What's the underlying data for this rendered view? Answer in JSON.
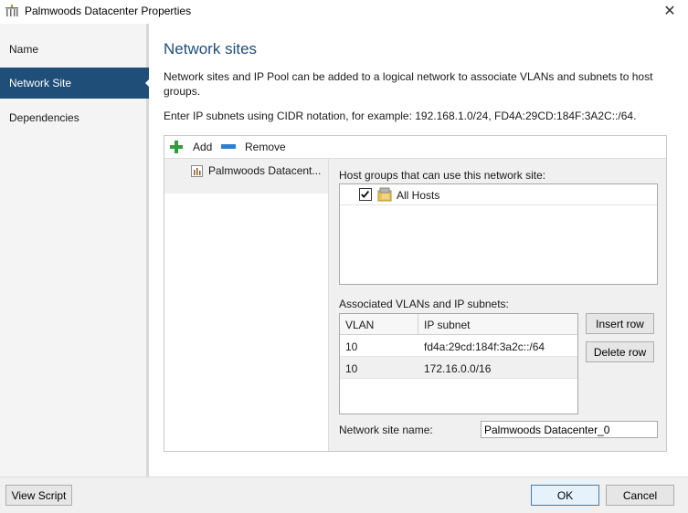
{
  "window": {
    "title": "Palmwoods Datacenter Properties",
    "close_glyph": "✕"
  },
  "sidebar": {
    "items": [
      {
        "label": "Name"
      },
      {
        "label": "Network Site"
      },
      {
        "label": "Dependencies"
      }
    ],
    "active_index": 1
  },
  "main": {
    "title": "Network sites",
    "description": "Network sites and IP Pool can be added to a logical network to associate VLANs and subnets to host groups.",
    "cidr_hint": "Enter IP subnets using CIDR notation, for example: 192.168.1.0/24, FD4A:29CD:184F:3A2C::/64.",
    "toolbar": {
      "add_label": "Add",
      "remove_label": "Remove"
    },
    "sites": [
      {
        "label": "Palmwoods Datacent..."
      }
    ],
    "host_groups_label": "Host groups that can use this network site:",
    "host_groups": [
      {
        "label": "All Hosts",
        "checked": true
      }
    ],
    "vlans_label": "Associated VLANs and IP subnets:",
    "vlan_table": {
      "headers": [
        "VLAN",
        "IP subnet"
      ],
      "rows": [
        {
          "vlan": "10",
          "subnet": "fd4a:29cd:184f:3a2c::/64"
        },
        {
          "vlan": "10",
          "subnet": "172.16.0.0/16"
        }
      ]
    },
    "insert_row_label": "Insert row",
    "delete_row_label": "Delete row",
    "site_name_label": "Network site name:",
    "site_name_value": "Palmwoods Datacenter_0"
  },
  "footer": {
    "view_script_label": "View Script",
    "ok_label": "OK",
    "cancel_label": "Cancel"
  },
  "colors": {
    "accent": "#1f4e79",
    "add_green": "#2e9e3a",
    "remove_blue": "#2a7fd4"
  }
}
